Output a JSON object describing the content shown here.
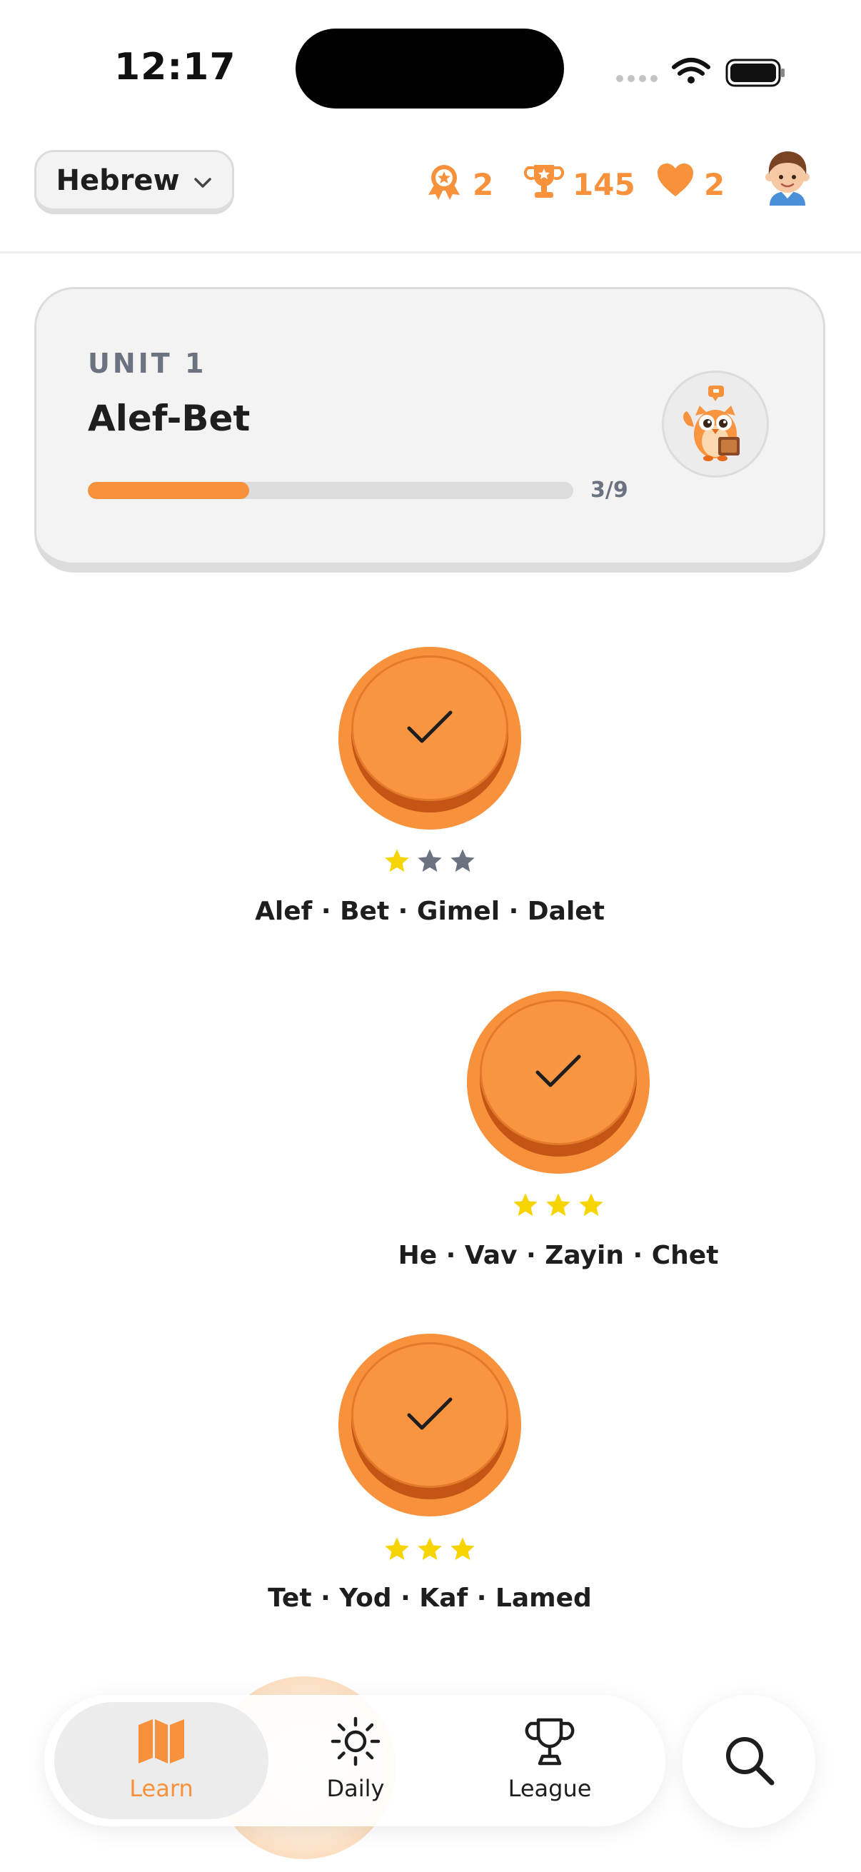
{
  "status_bar": {
    "time": "12:17"
  },
  "header": {
    "language": "Hebrew",
    "stats": {
      "badges": "2",
      "trophies": "145",
      "hearts": "2"
    }
  },
  "unit": {
    "label": "UNIT 1",
    "title": "Alef-Bet",
    "progress_text": "3/9",
    "progress_fraction": 0.333
  },
  "lessons": [
    {
      "label": "Alef · Bet · Gimel · Dalet",
      "stars_earned": 1,
      "stars_total": 3,
      "completed": true
    },
    {
      "label": "He · Vav · Zayin · Chet",
      "stars_earned": 3,
      "stars_total": 3,
      "completed": true
    },
    {
      "label": "Tet · Yod · Kaf · Lamed",
      "stars_earned": 3,
      "stars_total": 3,
      "completed": true
    }
  ],
  "nav": {
    "learn": "Learn",
    "daily": "Daily",
    "league": "League"
  },
  "colors": {
    "accent": "#f7913b",
    "accent_dark": "#c55514",
    "star_filled": "#f5d400",
    "star_empty": "#6b7280"
  },
  "icons": {
    "language_chevron": "chevron-down-icon",
    "badges": "award-icon",
    "trophies": "trophy-icon",
    "hearts": "heart-icon",
    "lesson_done": "checkmark-icon",
    "nav_learn": "map-icon",
    "nav_daily": "sun-icon",
    "nav_league": "trophy-icon",
    "search": "search-icon"
  }
}
